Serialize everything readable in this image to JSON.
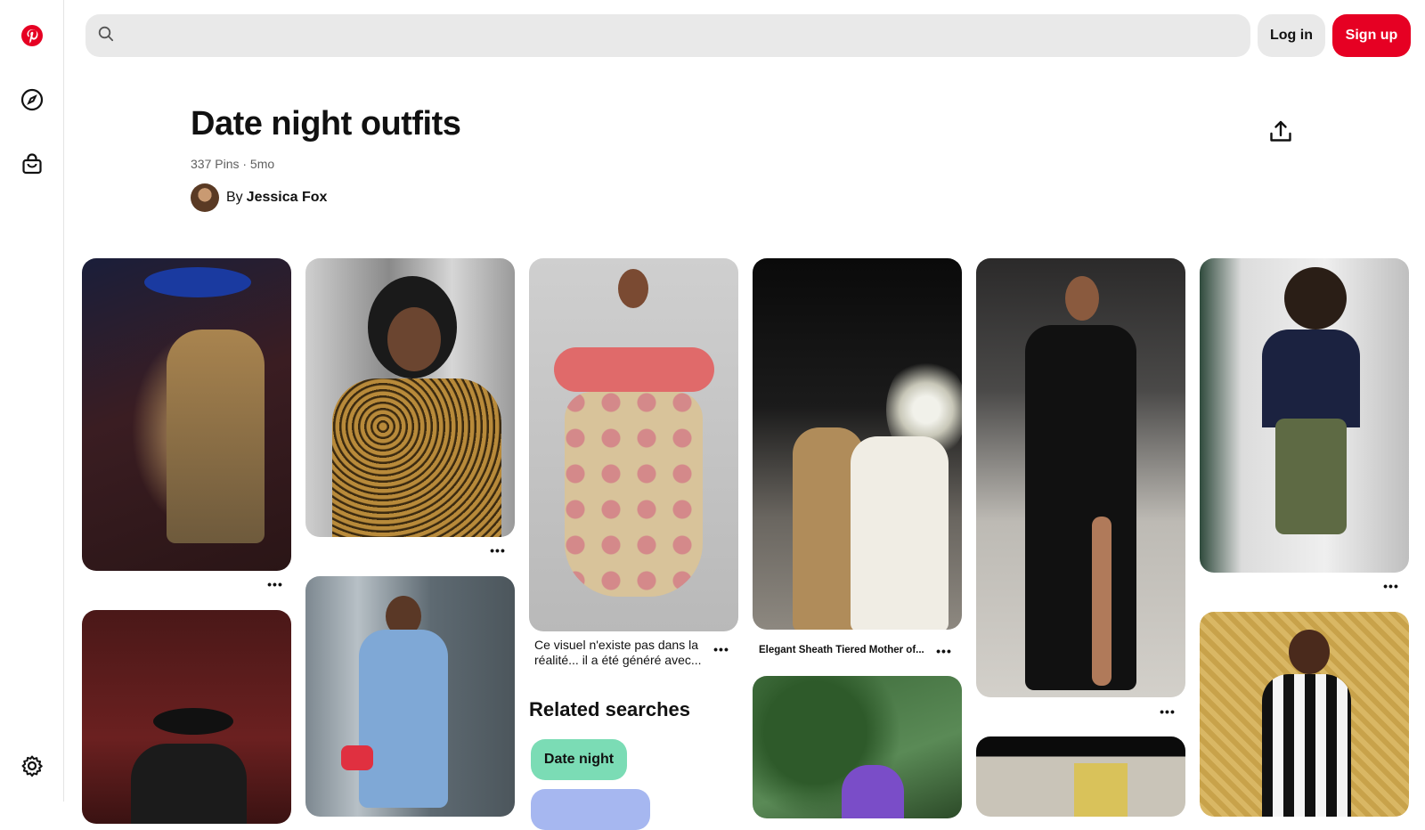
{
  "sidebar": {
    "items": [
      {
        "icon": "pinterest-logo-icon"
      },
      {
        "icon": "compass-icon"
      },
      {
        "icon": "shopping-bag-icon"
      },
      {
        "icon": "gear-icon"
      }
    ]
  },
  "header": {
    "search_placeholder": "",
    "login_label": "Log in",
    "signup_label": "Sign up",
    "signup_color": "#e60023"
  },
  "board": {
    "title": "Date night outfits",
    "meta": "337 Pins · 5mo",
    "by_label": "By",
    "owner_name": "Jessica Fox"
  },
  "pins": {
    "p3_caption": "Ce visuel n'existe pas dans la réalité... il a été généré avec...",
    "p4_caption": "Elegant Sheath Tiered Mother of..."
  },
  "related": {
    "title": "Related searches",
    "chips": [
      {
        "label": "Date night",
        "color": "#7bdcb5"
      },
      {
        "label": "",
        "color": "#a6b7f0"
      }
    ]
  }
}
